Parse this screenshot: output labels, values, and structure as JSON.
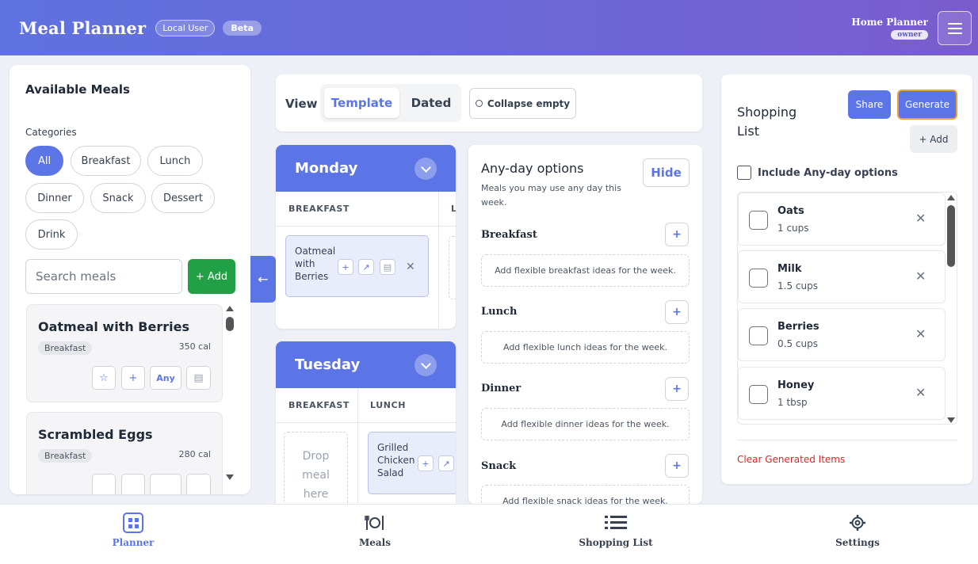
{
  "header": {
    "title": "Meal Planner",
    "local_badge": "Local User",
    "beta_badge": "Beta",
    "user_name": "Home Planner",
    "user_role": "owner"
  },
  "available": {
    "title": "Available Meals",
    "categories_label": "Categories",
    "categories": [
      "All",
      "Breakfast",
      "Lunch",
      "Dinner",
      "Snack",
      "Dessert",
      "Drink"
    ],
    "active_category": "All",
    "search_placeholder": "Search meals",
    "add_label": "+ Add",
    "meals": [
      {
        "name": "Oatmeal with Berries",
        "category": "Breakfast",
        "calories": "350 cal",
        "any_label": "Any"
      },
      {
        "name": "Scrambled Eggs",
        "category": "Breakfast",
        "calories": "280 cal"
      }
    ]
  },
  "view": {
    "label": "View",
    "template": "Template",
    "dated": "Dated",
    "active": "Template",
    "collapse_empty": "Collapse empty"
  },
  "days": [
    {
      "name": "Monday",
      "columns": [
        "BREAKFAST",
        "L"
      ],
      "meal": "Oatmeal with Berries",
      "meal_lines": [
        "Oatmeal",
        "with",
        "Berries"
      ]
    },
    {
      "name": "Tuesday",
      "columns": [
        "BREAKFAST",
        "LUNCH"
      ],
      "dropzone_lines": [
        "Drop",
        "meal",
        "here"
      ],
      "meal": "Grilled Chicken Salad",
      "meal_lines": [
        "Grilled",
        "Chicken",
        "Salad"
      ]
    }
  ],
  "anyday": {
    "title": "Any-day options",
    "subtitle": "Meals you may use any day this week.",
    "hide_label": "Hide",
    "sections": [
      {
        "title": "Breakfast",
        "placeholder": "Add flexible breakfast ideas for the week."
      },
      {
        "title": "Lunch",
        "placeholder": "Add flexible lunch ideas for the week."
      },
      {
        "title": "Dinner",
        "placeholder": "Add flexible dinner ideas for the week."
      },
      {
        "title": "Snack",
        "placeholder": "Add flexible snack ideas for the week."
      }
    ]
  },
  "shopping": {
    "title": "Shopping List",
    "share_label": "Share",
    "generate_label": "Generate",
    "add_label": "+ Add",
    "include_label": "Include Any-day options",
    "items": [
      {
        "name": "Oats",
        "qty": "1 cups"
      },
      {
        "name": "Milk",
        "qty": "1.5 cups"
      },
      {
        "name": "Berries",
        "qty": "0.5 cups"
      },
      {
        "name": "Honey",
        "qty": "1 tbsp"
      }
    ],
    "clear_label": "Clear Generated Items"
  },
  "nav": {
    "items": [
      {
        "label": "Planner",
        "icon": "calendar-grid-icon",
        "active": true
      },
      {
        "label": "Meals",
        "icon": "utensils-icon"
      },
      {
        "label": "Shopping List",
        "icon": "list-icon"
      },
      {
        "label": "Settings",
        "icon": "gear-icon"
      }
    ]
  },
  "colors": {
    "accent": "#5b75e6",
    "add_green": "#22a045",
    "danger": "#dc2626",
    "generate_border": "#f0a030"
  }
}
